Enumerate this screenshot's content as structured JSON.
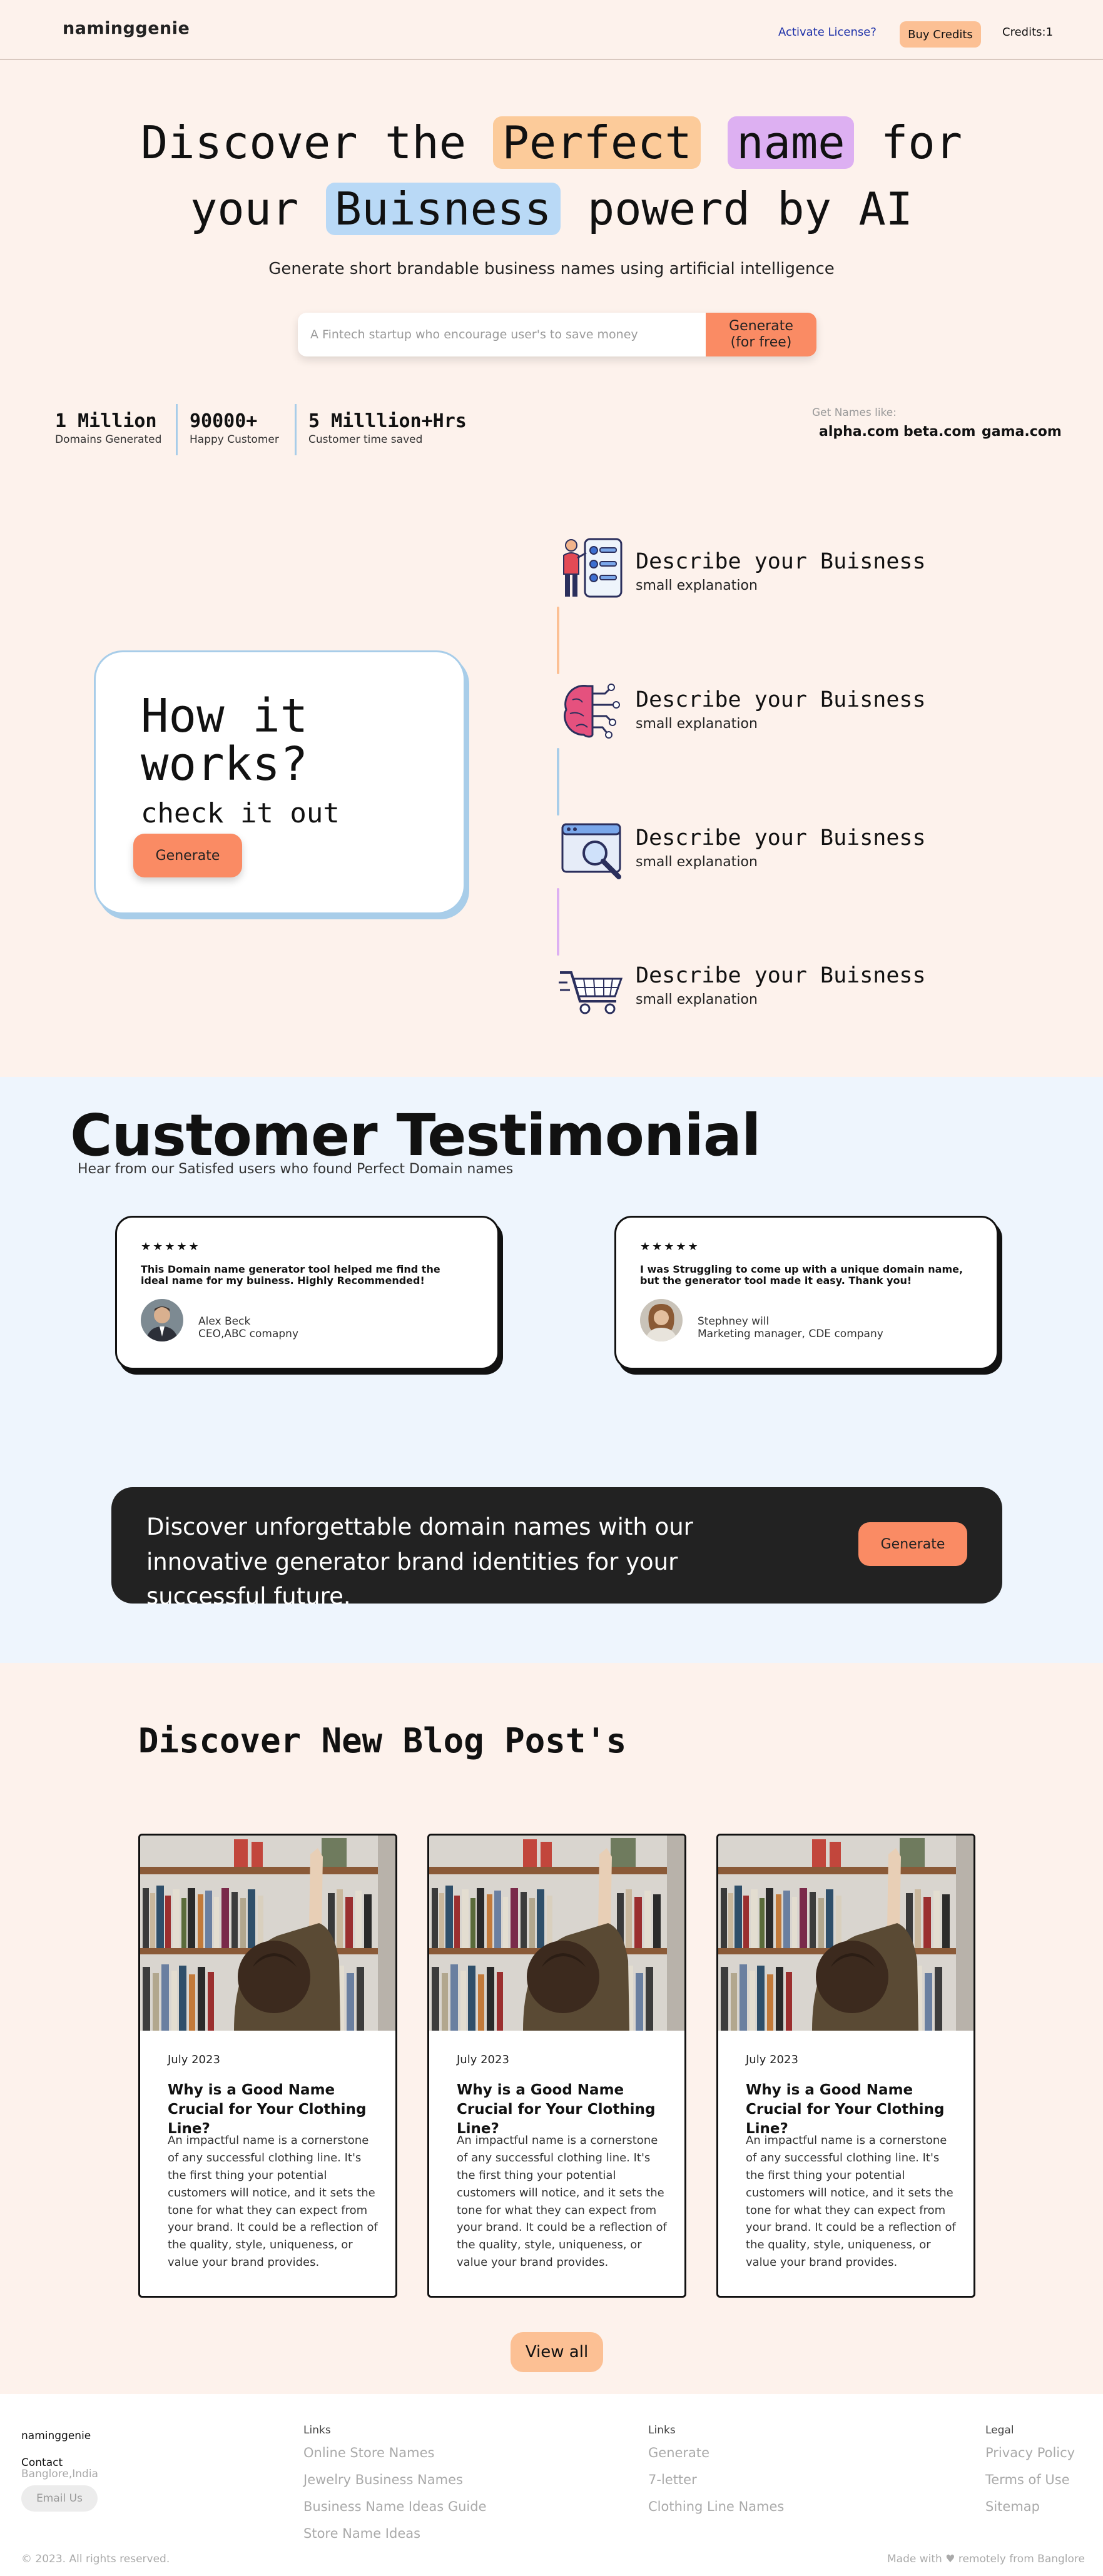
{
  "nav": {
    "logo": "naminggenie",
    "activate_license": "Activate License?",
    "buy_credits": "Buy Credits",
    "credits": "Credits:1"
  },
  "hero": {
    "title_pre": "Discover the",
    "title_hl1": "Perfect",
    "title_hl2": "name",
    "title_mid": "for",
    "title_l2_pre": "your",
    "title_hl3": "Buisness",
    "title_l2_post": "powerd by AI",
    "subtitle": "Generate short brandable business names using artificial intelligence",
    "search_placeholder": "A Fintech startup who encourage user's to save money",
    "generate_line1": "Generate",
    "generate_line2": "(for free)",
    "colors": {
      "orange": "#fccb9a",
      "purple": "#ddb0f2",
      "blue": "#b9d9f6"
    }
  },
  "stats": [
    {
      "num": "1 Million",
      "label": "Domains Generated"
    },
    {
      "num": "90000+",
      "label": "Happy Customer"
    },
    {
      "num": "5 Milllion+Hrs",
      "label": "Customer time saved"
    }
  ],
  "names_like": {
    "label": "Get Names like:",
    "examples": [
      "alpha.com",
      "beta.com",
      "gama.com"
    ]
  },
  "how": {
    "title_l1": "How it",
    "title_l2": "works?",
    "subtitle": "check it out",
    "button": "Generate",
    "steps": [
      {
        "title": "Describe your Buisness",
        "sub": "small explanation",
        "icon": "presenter-checklist-icon",
        "line_color": "#fcc094"
      },
      {
        "title": "Describe your Buisness",
        "sub": "small explanation",
        "icon": "brain-circuit-icon",
        "line_color": "#a8cde9"
      },
      {
        "title": "Describe your Buisness",
        "sub": "small explanation",
        "icon": "browser-search-icon",
        "line_color": "#ddb0f2"
      },
      {
        "title": "Describe your Buisness",
        "sub": "small explanation",
        "icon": "shopping-cart-icon"
      }
    ]
  },
  "testimonials": {
    "title": "Customer Testimonial",
    "subtitle": "Hear from our Satisfed users who found Perfect Domain names",
    "items": [
      {
        "stars": "★★★★★",
        "quote": "This Domain name generator tool helped me find the ideal name for my buiness. Highly Recommended!",
        "name": "Alex Beck",
        "role": "CEO,ABC comapny"
      },
      {
        "stars": "★★★★★",
        "quote": "I was Struggling to come up with a unique domain name, but the generator tool made it easy. Thank you!",
        "name": "Stephney will",
        "role": "Marketing manager, CDE company"
      }
    ]
  },
  "cta": {
    "text": "Discover unforgettable domain names with our innovative generator brand identities for your successful future.",
    "button": "Generate"
  },
  "blog": {
    "title": "Discover New Blog Post's",
    "posts": [
      {
        "date": "July 2023",
        "title": "Why is a Good Name Crucial for Your Clothing Line?",
        "body": "An impactful name is a cornerstone of any successful clothing line. It's the first thing your potential customers will notice, and it sets the tone for what they can expect from your brand. It could be a reflection of the quality, style, uniqueness, or value your brand provides."
      },
      {
        "date": "July 2023",
        "title": "Why is a Good Name Crucial for Your Clothing Line?",
        "body": "An impactful name is a cornerstone of any successful clothing line. It's the first thing your potential customers will notice, and it sets the tone for what they can expect from your brand. It could be a reflection of the quality, style, uniqueness, or value your brand provides."
      },
      {
        "date": "July 2023",
        "title": "Why is a Good Name Crucial for Your Clothing Line?",
        "body": "An impactful name is a cornerstone of any successful clothing line. It's the first thing your potential customers will notice, and it sets the tone for what they can expect from your brand. It could be a reflection of the quality, style, uniqueness, or value your brand provides."
      }
    ],
    "view_all": "View all"
  },
  "footer": {
    "brand": "naminggenie",
    "contact": "Contact",
    "location": "Banglore,India",
    "email_button": "Email Us",
    "col1": {
      "head": "Links",
      "links": [
        "Online Store Names",
        "Jewelry Business Names",
        "Business Name Ideas Guide",
        "Store Name Ideas"
      ]
    },
    "col2": {
      "head": "Links",
      "links": [
        "Generate",
        "7-letter",
        "Clothing Line Names"
      ]
    },
    "col3": {
      "head": "Legal",
      "links": [
        "Privacy Policy",
        "Terms of Use",
        "Sitemap"
      ]
    },
    "copyright": "© 2023. All rights reserved.",
    "made_with": "Made with ♥ remotely from Banglore"
  }
}
